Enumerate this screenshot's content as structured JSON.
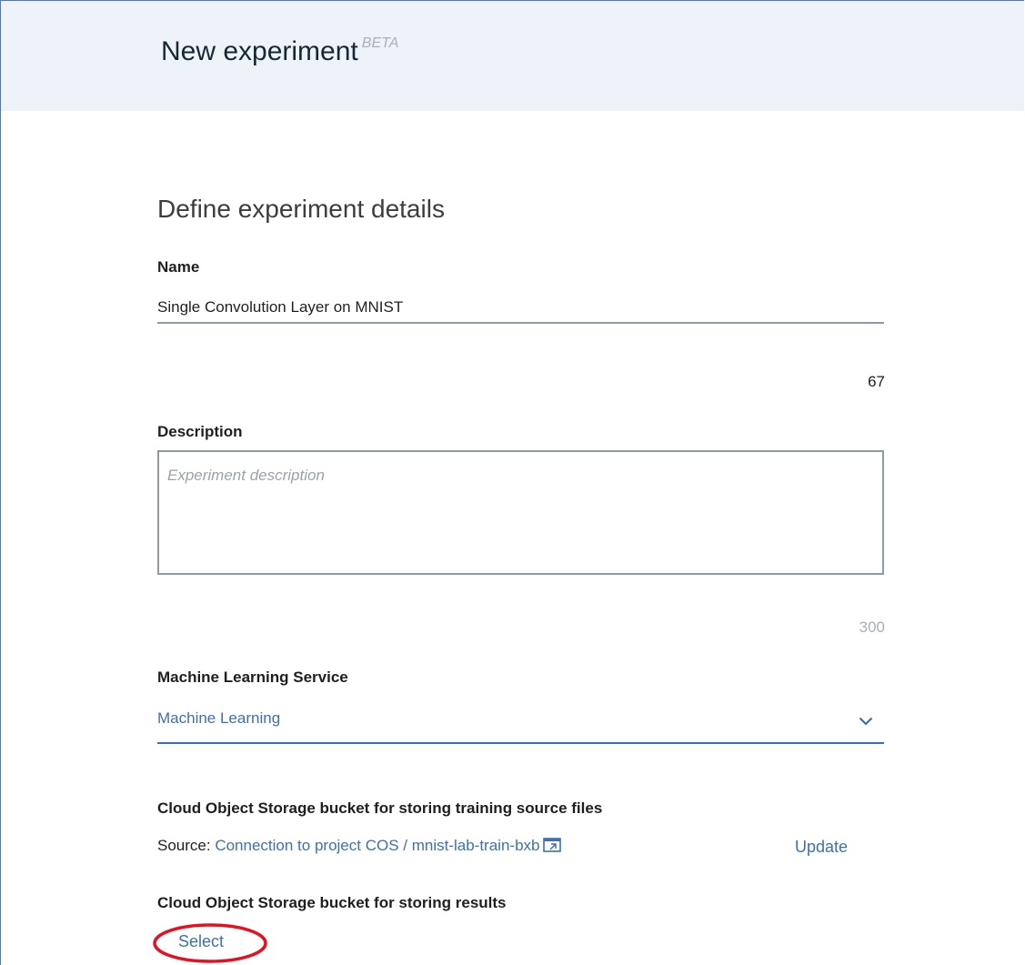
{
  "header": {
    "title": "New experiment",
    "badge": "BETA"
  },
  "form": {
    "section_title": "Define experiment details",
    "name": {
      "label": "Name",
      "value": "Single Convolution Layer on MNIST",
      "remaining": "67"
    },
    "description": {
      "label": "Description",
      "placeholder": "Experiment description",
      "remaining": "300"
    },
    "ml_service": {
      "label": "Machine Learning Service",
      "selected": "Machine Learning"
    },
    "training_bucket": {
      "label": "Cloud Object Storage bucket for storing training source files",
      "source_prefix": "Source:",
      "source_link": "Connection to project COS / mnist-lab-train-bxb",
      "update_label": "Update"
    },
    "results_bucket": {
      "label": "Cloud Object Storage bucket for storing results",
      "select_label": "Select"
    }
  },
  "colors": {
    "accent": "#3d70b2",
    "header_bg": "#eef3f9",
    "annotation": "#e8101e"
  },
  "icons": {
    "dropdown": "chevron-down-icon",
    "external": "external-link-icon"
  }
}
